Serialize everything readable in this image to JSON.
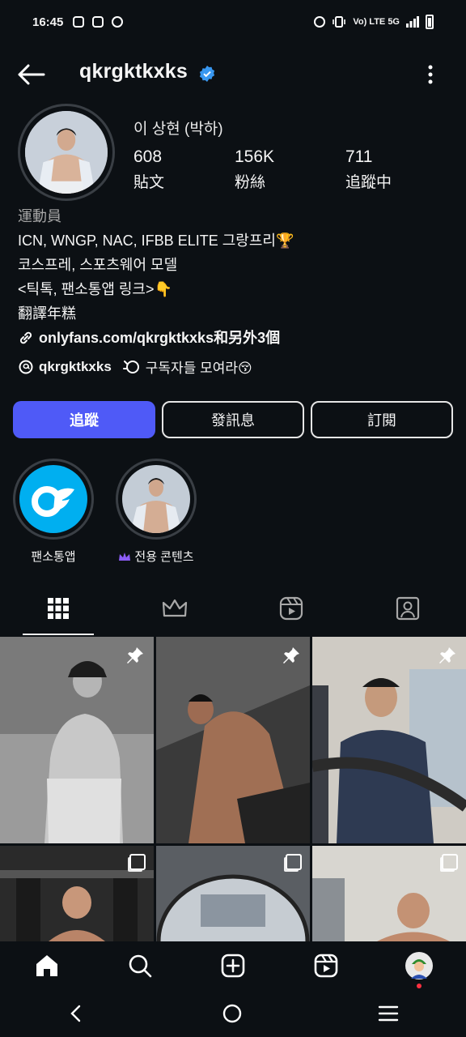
{
  "status_bar": {
    "time": "16:45",
    "network": "Vo) LTE 5G"
  },
  "header": {
    "username": "qkrgktkxks"
  },
  "profile": {
    "display_name": "이 상현 (박하)",
    "stats": [
      {
        "value": "608",
        "label": "貼文"
      },
      {
        "value": "156K",
        "label": "粉絲"
      },
      {
        "value": "711",
        "label": "追蹤中"
      }
    ],
    "category": "運動員",
    "bio_lines": [
      "ICN, WNGP,  NAC, IFBB ELITE 그랑프리🏆",
      "코스프레, 스포츠웨어 모델",
      "<틱톡, 팬소통앱 링크>👇",
      "翻譯年糕"
    ],
    "link_text": "onlyfans.com/qkrgktkxks和另外3個",
    "threads_handle": "qkrgktkxks",
    "channel_text": "구독자들 모여라😚"
  },
  "buttons": {
    "follow": "追蹤",
    "message": "發訊息",
    "subscribe": "訂閱"
  },
  "highlights": [
    {
      "label": "팬소통앱"
    },
    {
      "label": "전용 콘텐츠"
    }
  ],
  "colors": {
    "background": "#0c1014",
    "accent": "#4f5af7",
    "verified": "#3897f0",
    "onlyfans_blue": "#00aff0",
    "notification_dot": "#ff3040",
    "subscriber_crown": "#8b5cf6"
  }
}
